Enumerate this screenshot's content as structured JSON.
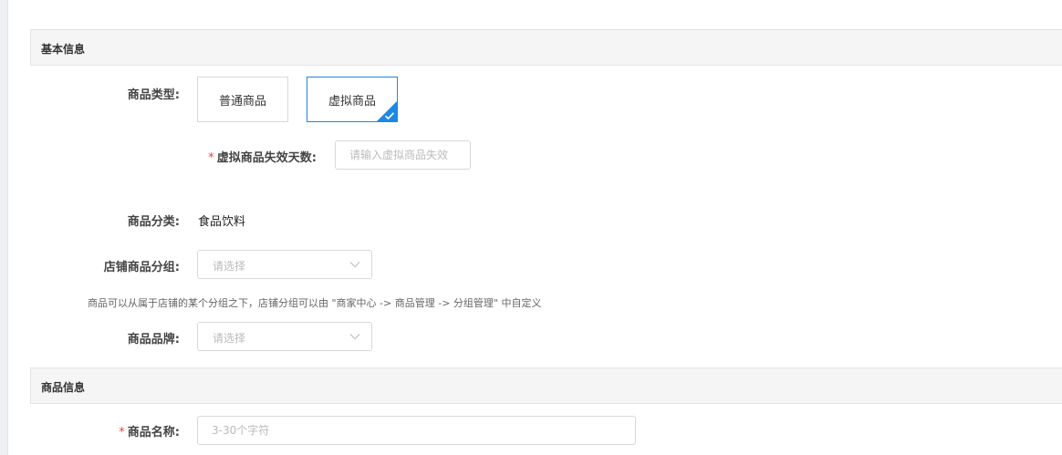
{
  "sections": {
    "basic_info": "基本信息",
    "product_info": "商品信息"
  },
  "form": {
    "product_type": {
      "label": "商品类型:",
      "options": [
        "普通商品",
        "虚拟商品"
      ],
      "selected": "虚拟商品"
    },
    "virtual_expiry": {
      "required_mark": "*",
      "label": "虚拟商品失效天数:",
      "placeholder": "请输入虚拟商品失效"
    },
    "category": {
      "label": "商品分类:",
      "value": "食品饮料"
    },
    "store_group": {
      "label": "店铺商品分组:",
      "placeholder": "请选择",
      "hint": "商品可以从属于店铺的某个分组之下，店铺分组可以由 \"商家中心 -> 商品管理 -> 分组管理\" 中自定义"
    },
    "brand": {
      "label": "商品品牌:",
      "placeholder": "请选择"
    },
    "product_name": {
      "required_mark": "*",
      "label": "商品名称:",
      "placeholder": "3-30个字符"
    }
  },
  "icons": {
    "selected_check": "check-icon",
    "dropdown": "chevron-down-icon"
  },
  "colors": {
    "accent": "#1e88e5",
    "required": "#f04134"
  }
}
